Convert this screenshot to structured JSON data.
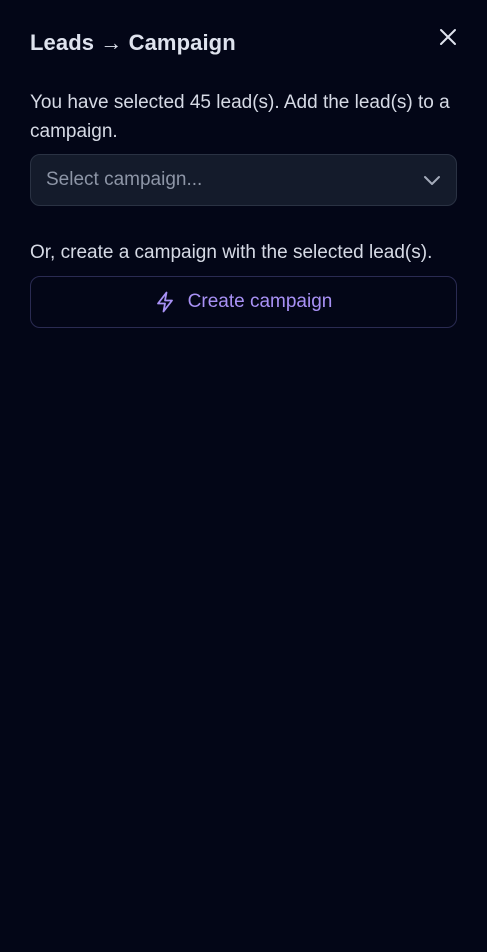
{
  "panel": {
    "title": "Leads → Campaign",
    "close_icon": "close-icon"
  },
  "add_section": {
    "description": "You have selected 45 lead(s). Add the lead(s) to a campaign.",
    "select": {
      "placeholder": "Select campaign...",
      "icon": "chevron-down-icon"
    }
  },
  "create_section": {
    "description": "Or, create a campaign with the selected lead(s).",
    "button_label": "Create campaign",
    "button_icon": "lightning-icon"
  },
  "colors": {
    "background": "#030617",
    "accent": "#a891f5",
    "text": "#d6dae5",
    "placeholder": "#8d95a6"
  }
}
